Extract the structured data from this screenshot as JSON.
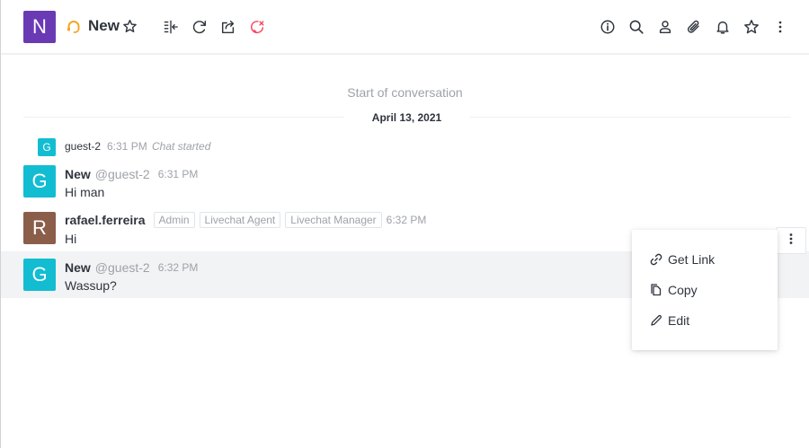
{
  "header": {
    "room_initial": "N",
    "room_title": "New",
    "icons": [
      "livechat-icon",
      "star-icon",
      "forward-chat-icon",
      "transcript-icon",
      "close-chat-icon",
      "info-icon",
      "search-icon",
      "members-icon",
      "attachment-icon",
      "notifications-icon",
      "star-icon",
      "kebab-menu-icon"
    ]
  },
  "conversation": {
    "start_text": "Start of conversation",
    "date": "April 13, 2021",
    "system_message": {
      "avatar_initial": "G",
      "user": "guest-2",
      "time": "6:31 PM",
      "text": "Chat started"
    },
    "messages": [
      {
        "avatar_initial": "G",
        "avatar_color": "#12bdd2",
        "name": "New",
        "username": "@guest-2",
        "roles": [],
        "time": "6:31 PM",
        "text": "Hi man"
      },
      {
        "avatar_initial": "R",
        "avatar_color": "#8b5e4a",
        "name": "rafael.ferreira",
        "username": "",
        "roles": [
          "Admin",
          "Livechat Agent",
          "Livechat Manager"
        ],
        "time": "6:32 PM",
        "text": "Hi"
      },
      {
        "avatar_initial": "G",
        "avatar_color": "#12bdd2",
        "name": "New",
        "username": "@guest-2",
        "roles": [],
        "time": "6:32 PM",
        "text": "Wassup?"
      }
    ]
  },
  "context_menu": {
    "items": [
      {
        "label": "Get Link",
        "icon": "link-icon"
      },
      {
        "label": "Copy",
        "icon": "copy-icon"
      },
      {
        "label": "Edit",
        "icon": "edit-icon"
      }
    ]
  },
  "colors": {
    "room_avatar": "#6a3ab5",
    "livechat_icon": "#f5a623",
    "close_chat_icon": "#f5455c",
    "highlight_row": "#f2f3f5"
  }
}
